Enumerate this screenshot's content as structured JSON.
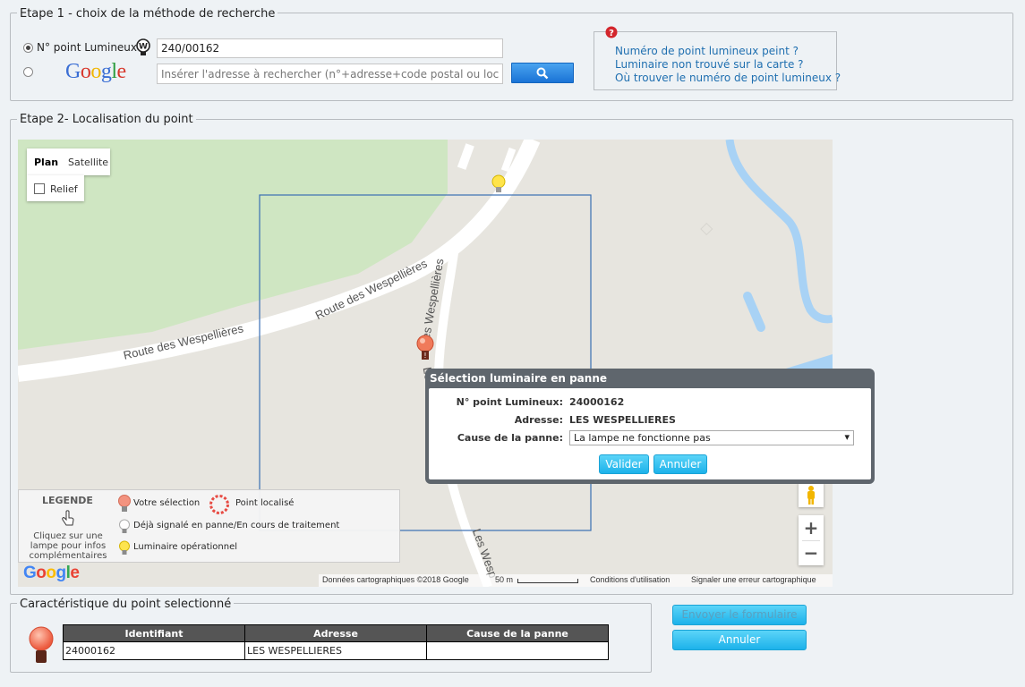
{
  "step1": {
    "legend": "Etape 1 - choix de la méthode de recherche",
    "radio_point_label": "N° point Lumineux",
    "point_value": "240/00162",
    "google_logo": "Google",
    "address_placeholder": "Insérer l'adresse à rechercher (n°+adresse+code postal ou localité)",
    "search_icon": "search-icon",
    "help_links": [
      "Numéro de point lumineux peint ?",
      "Luminaire non trouvé sur la carte ?",
      "Où trouver le numéro de point lumineux ?"
    ]
  },
  "step2": {
    "legend": "Etape 2- Localisation du point",
    "map_type": {
      "plan": "Plan",
      "satellite": "Satellite",
      "relief": "Relief"
    },
    "road_labels": [
      "Route des Wespellières",
      "Route des Wespellières",
      "Les Wespellières",
      "Le",
      "Les Wesp"
    ],
    "legend_box": {
      "title": "LEGENDE",
      "hint": "Cliquez sur une lampe pour infos complémentaires",
      "items": [
        "Votre sélection",
        "Point localisé",
        "Déjà signalé en panne/En cours de traitement",
        "Luminaire opérationnel"
      ]
    },
    "zoom_in": "+",
    "zoom_out": "−",
    "google_logo": "Google",
    "attribution": {
      "data": "Données cartographiques ©2018 Google",
      "scale": "50 m",
      "terms": "Conditions d'utilisation",
      "report": "Signaler une erreur cartographique"
    },
    "dialog": {
      "title": "Sélection luminaire en panne",
      "point_label": "N° point Lumineux:",
      "point_value": "24000162",
      "address_label": "Adresse:",
      "address_value": "LES WESPELLIERES",
      "cause_label": "Cause de la panne:",
      "cause_value": "La lampe ne fonctionne pas",
      "validate": "Valider",
      "cancel": "Annuler"
    }
  },
  "step3": {
    "legend": "Caractéristique du point selectionné",
    "columns": [
      "Identifiant",
      "Adresse",
      "Cause de la panne"
    ],
    "row": [
      "24000162",
      "LES WESPELLIERES",
      ""
    ]
  },
  "actions": {
    "send": "Envoyer le formulaire",
    "cancel": "Annuler"
  },
  "colors": {
    "accent": "#1cb2ea",
    "link": "#1f6fb0",
    "park": "#cfe6c2",
    "water": "#a8d2f5"
  }
}
